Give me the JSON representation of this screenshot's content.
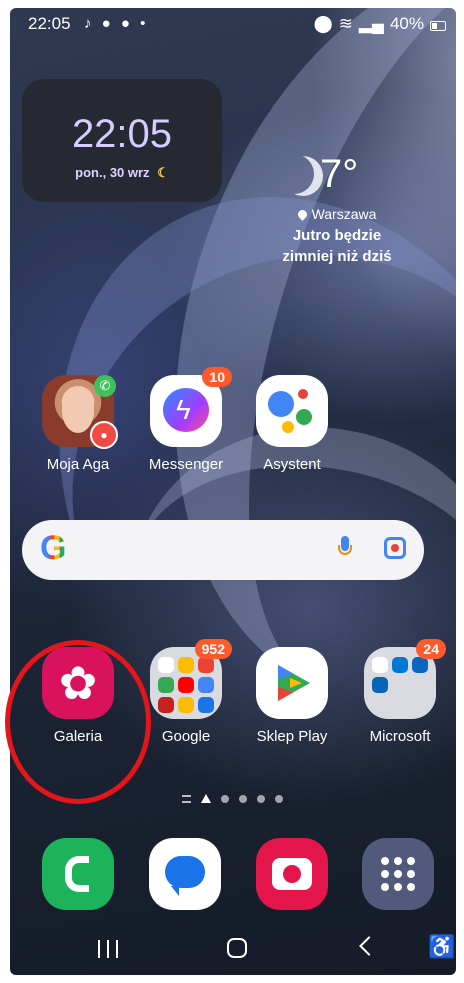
{
  "status_bar": {
    "time": "22:05",
    "notification_icons": "♪ ● ● •",
    "battery": "40%"
  },
  "clock_widget": {
    "time": "22:05",
    "date": "pon., 30 wrz"
  },
  "weather": {
    "temperature": "7°",
    "location": "Warszawa",
    "forecast_line1": "Jutro będzie",
    "forecast_line2": "zimniej niż dziś"
  },
  "apps_row1": [
    {
      "label": "Moja Aga"
    },
    {
      "label": "Messenger",
      "badge": "10"
    },
    {
      "label": "Asystent"
    }
  ],
  "apps_row2": [
    {
      "label": "Galeria"
    },
    {
      "label": "Google",
      "badge": "952"
    },
    {
      "label": "Sklep Play"
    },
    {
      "label": "Microsoft",
      "badge": "24"
    }
  ],
  "search_bar": {
    "logo": "G"
  },
  "colors": {
    "badge": "#ff5a2b",
    "highlight_circle": "#e5161b",
    "gallery": "#d8125c",
    "phone": "#1db35a",
    "camera": "#e3154a"
  }
}
